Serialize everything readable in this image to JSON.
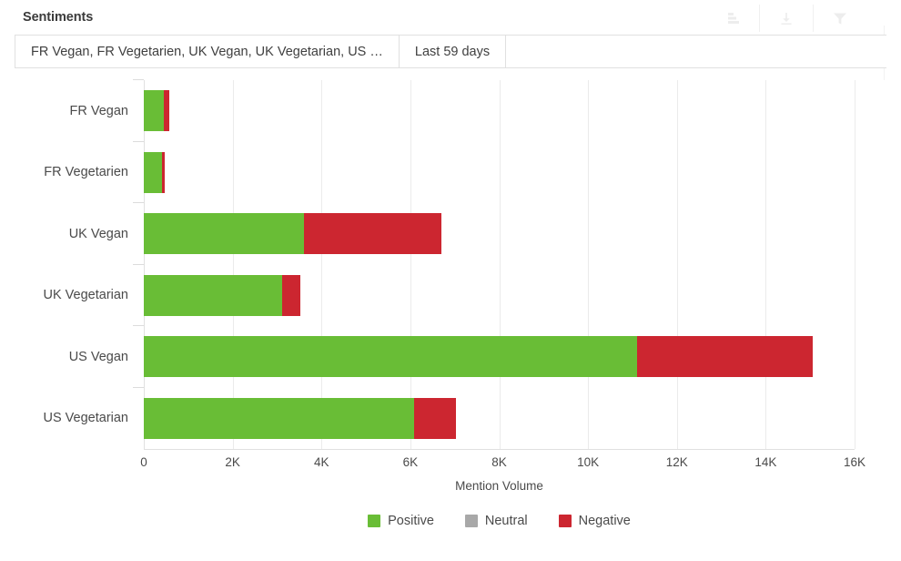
{
  "header": {
    "title": "Sentiments",
    "tools": [
      {
        "name": "bar-chart-icon",
        "label": "chart view"
      },
      {
        "name": "download-icon",
        "label": "download"
      },
      {
        "name": "filter-icon",
        "label": "filter"
      }
    ]
  },
  "filters": {
    "tabs": [
      {
        "label": "FR Vegan, FR Vegetarien, UK Vegan, UK Vegetarian, US …"
      },
      {
        "label": "Last 59 days"
      }
    ]
  },
  "chart_data": {
    "type": "bar",
    "orientation": "horizontal",
    "stacked": true,
    "title": "Sentiments",
    "xlabel": "Mention Volume",
    "ylabel": "",
    "xlim": [
      0,
      16000
    ],
    "xticks": [
      0,
      2000,
      4000,
      6000,
      8000,
      10000,
      12000,
      14000,
      16000
    ],
    "xtick_labels": [
      "0",
      "2K",
      "4K",
      "6K",
      "8K",
      "10K",
      "12K",
      "14K",
      "16K"
    ],
    "grid": true,
    "legend_position": "bottom",
    "categories": [
      "FR Vegan",
      "FR Vegetarien",
      "UK Vegan",
      "UK Vegetarian",
      "US Vegan",
      "US Vegetarian"
    ],
    "series": [
      {
        "name": "Positive",
        "color": "#69bd36",
        "values": [
          460,
          400,
          3600,
          3120,
          11100,
          6080
        ]
      },
      {
        "name": "Neutral",
        "color": "#a8a8a8",
        "values": [
          0,
          0,
          0,
          0,
          0,
          0
        ]
      },
      {
        "name": "Negative",
        "color": "#cc2630",
        "values": [
          120,
          80,
          3100,
          400,
          3950,
          940
        ]
      }
    ],
    "totals": [
      580,
      480,
      6700,
      3520,
      15050,
      7020
    ]
  }
}
